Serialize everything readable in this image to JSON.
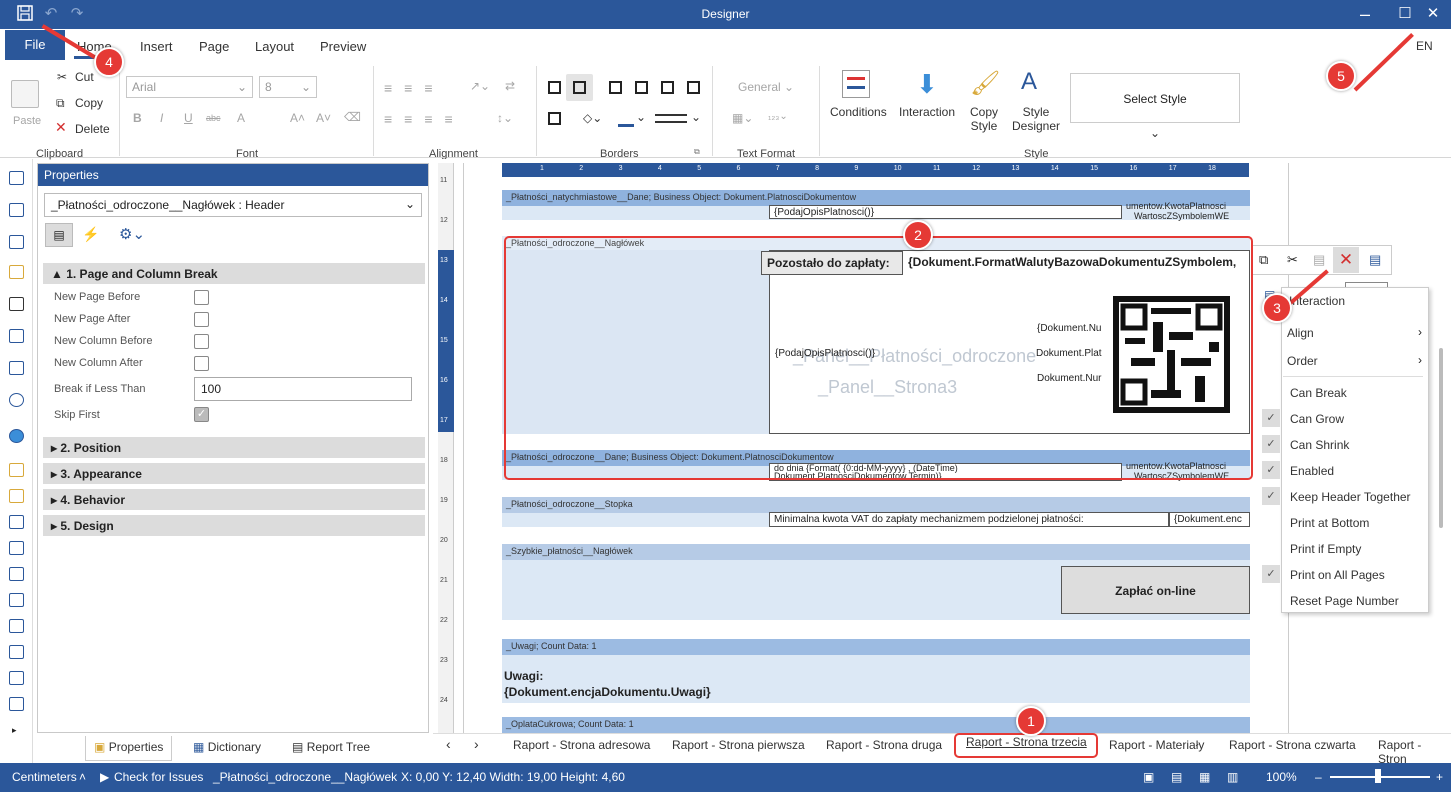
{
  "titlebar": {
    "title": "Designer"
  },
  "menu": {
    "file": "File",
    "tabs": [
      "Home",
      "Insert",
      "Page",
      "Layout",
      "Preview"
    ],
    "lang": "EN"
  },
  "ribbon": {
    "clipboard": {
      "paste": "Paste",
      "cut": "Cut",
      "copy": "Copy",
      "delete": "Delete",
      "label": "Clipboard"
    },
    "font": {
      "family": "Arial",
      "size": "8",
      "label": "Font"
    },
    "alignment": {
      "label": "Alignment"
    },
    "borders": {
      "label": "Borders"
    },
    "text_format": {
      "general": "General",
      "label": "Text Format"
    },
    "style": {
      "conditions": "Conditions",
      "interaction": "Interaction",
      "copy_style": "Copy Style",
      "style_designer": "Style Designer",
      "select_style": "Select Style",
      "label": "Style"
    }
  },
  "properties": {
    "title": "Properties",
    "selector": "_Płatności_odroczone__Nagłówek : Header",
    "sections": [
      "1. Page and Column Break",
      "2. Position",
      "3. Appearance",
      "4. Behavior",
      "5. Design"
    ],
    "fields": [
      {
        "label": "New Page Before"
      },
      {
        "label": "New Page After"
      },
      {
        "label": "New Column Before"
      },
      {
        "label": "New Column After"
      },
      {
        "label": "Break if Less Than",
        "value": "100"
      },
      {
        "label": "Skip First"
      }
    ]
  },
  "panel_tabs": [
    "Properties",
    "Dictionary",
    "Report Tree"
  ],
  "canvas": {
    "ruler_v": [
      "11",
      "12",
      "13",
      "14",
      "15",
      "16",
      "17",
      "18",
      "19",
      "20",
      "21",
      "22",
      "23",
      "24"
    ],
    "ruler_h": [
      "1",
      "2",
      "3",
      "4",
      "5",
      "6",
      "7",
      "8",
      "9",
      "10",
      "11",
      "12",
      "13",
      "14",
      "15",
      "16",
      "17",
      "18"
    ],
    "bands": [
      "_Płatności_natychmiastowe__Dane; Business Object: Dokument.PlatnosciDokumentow",
      "_Płatności_odroczone__Nagłówek",
      "_Płatności_odroczone__Dane; Business Object: Dokument.PlatnosciDokumentow",
      "_Płatności_odroczone__Stopka",
      "_Szybkie_płatności__Nagłówek",
      "_Uwagi; Count Data: 1",
      "_OplataCukrowa; Count Data: 1"
    ],
    "cells": {
      "podaj1": "{PodajOpisPlatnosci()}",
      "kwota1": "umentow.KwotaPlatnosci",
      "wart1": "WartoscZSymbolemWE",
      "pozostalo": "Pozostało do zapłaty:",
      "format": "{Dokument.FormatWalutyBazowaDokumentuZSymbolem,",
      "dokn1": "{Dokument.Nu",
      "dokp": "Dokument.Plat",
      "dokn2": "Dokument.Nur",
      "podaj2": "{PodajOpisPlatnosci()}",
      "wm1": "_Panel__Płatności_odroczone",
      "wm2": "_Panel__Strona3",
      "dodnia": "do dnia {Format( {0:dd-MM-yyyy} , (DateTime)",
      "dokterm": "Dokument.PlatnosciDokumentow.Termin)}",
      "kwota2": "umentow.KwotaPlatnosci",
      "wart2": "WartoscZSymbolemWE",
      "minimalna": "Minimalna kwota VAT do zapłaty mechanizmem podzielonej płatności:",
      "dokenc": "{Dokument.enc",
      "zaplac": "Zapłać on-line",
      "uwagi": "Uwagi:",
      "uwagi_expr": "{Dokument.encjaDokumentu.Uwagi}"
    }
  },
  "context_menu": {
    "items": [
      "Interaction",
      "Align",
      "Order",
      "Can Break",
      "Can Grow",
      "Can Shrink",
      "Enabled",
      "Keep Header Together",
      "Print at Bottom",
      "Print if Empty",
      "Print on All Pages",
      "Reset Page Number"
    ],
    "checked": [
      "Can Grow",
      "Can Shrink",
      "Enabled",
      "Keep Header Together",
      "Print on All Pages"
    ]
  },
  "tooltip": "Delete",
  "page_tabs": [
    "Raport - Strona adresowa",
    "Raport - Strona pierwsza",
    "Raport - Strona druga",
    "Raport - Strona trzecia",
    "Raport - Materiały",
    "Raport - Strona czwarta",
    "Raport - Stron"
  ],
  "statusbar": {
    "units": "Centimeters",
    "check": "Check for Issues",
    "component": "_Płatności_odroczone__Nagłówek",
    "coords": "X: 0,00  Y: 12,40  Width: 19,00  Height: 4,60",
    "zoom": "100%"
  },
  "badges": [
    "1",
    "2",
    "3",
    "4",
    "5"
  ],
  "accent": "#2b579a",
  "annotation": "#e53935"
}
